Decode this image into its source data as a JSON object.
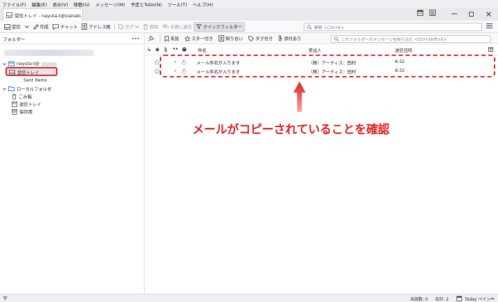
{
  "menubar": {
    "items": [
      "ファイル(F)",
      "編集(E)",
      "表示(V)",
      "移動(G)",
      "メッセージ(M)",
      "予定とToDo(N)",
      "ツール(T)",
      "ヘルプ(H)"
    ]
  },
  "tab": {
    "title": "受信トレイ - nayuta-t@izanaki.jp"
  },
  "toolbar": {
    "get_mail": "受信",
    "write": "作成",
    "chat": "チャット",
    "address_book": "アドレス帳",
    "tag": "タグ",
    "delete": "削除",
    "reply_all": "全員に返信",
    "quick_filter": "クイックフィルター"
  },
  "search": {
    "placeholder": "検索 <Ctrl+K>"
  },
  "folder_pane": {
    "header": "フォルダー",
    "more": "•••",
    "account": "nayuta-t@",
    "inbox": "受信トレイ",
    "sent_items": "Sent Items",
    "local_folders": "ローカルフォルダ",
    "trash": "ごみ箱",
    "outbox": "送信トレイ",
    "archive": "保存用"
  },
  "quick_filter_bar": {
    "unread": "未読",
    "starred": "スター付き",
    "contacts": "知り合い",
    "tags": "タグ付き",
    "attachments": "添付あり",
    "filter_placeholder": "このフォルダーのメッセージを絞り込む <Ctrl+Shift+K>"
  },
  "columns": {
    "subject": "件名",
    "sender": "差出人",
    "date": "送信日時"
  },
  "messages": [
    {
      "subject": "メール件名が入ります",
      "sender": "（株）アーティス：田村",
      "date": "8:32"
    },
    {
      "subject": "メール件名が入ります",
      "sender": "（株）アーティス：田村",
      "date": "8:32"
    }
  ],
  "annotation": {
    "text": "メールがコピーされていることを確認"
  },
  "status": {
    "unread": "未読数: 0",
    "total": "合計: 2",
    "today_pane": "Today ペイン"
  },
  "colors": {
    "annotation_red": "#e02020",
    "folder_blue": "#2a6fd8"
  }
}
